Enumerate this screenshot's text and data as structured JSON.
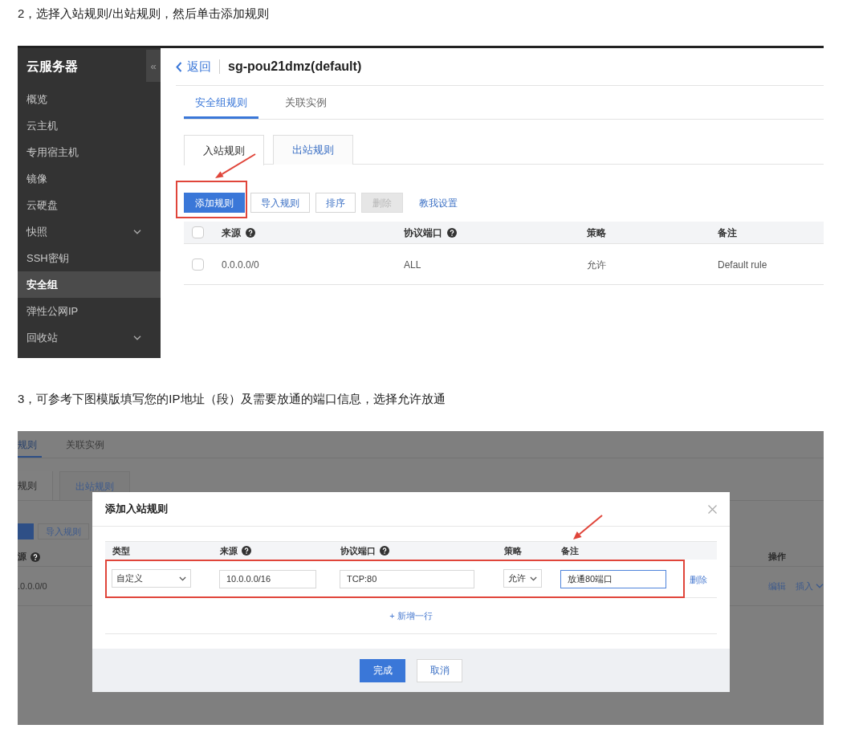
{
  "step_2": {
    "heading": "2，选择入站规则/出站规则，然后单击添加规则",
    "console": {
      "sidebar": {
        "title": "云服务器",
        "collapse": "«",
        "items": [
          {
            "label": "概览",
            "selected": false,
            "submenu": false
          },
          {
            "label": "云主机",
            "selected": false,
            "submenu": false
          },
          {
            "label": "专用宿主机",
            "selected": false,
            "submenu": false
          },
          {
            "label": "镜像",
            "selected": false,
            "submenu": false
          },
          {
            "label": "云硬盘",
            "selected": false,
            "submenu": false
          },
          {
            "label": "快照",
            "selected": false,
            "submenu": true
          },
          {
            "label": "SSH密钥",
            "selected": false,
            "submenu": false
          },
          {
            "label": "安全组",
            "selected": true,
            "submenu": false
          },
          {
            "label": "弹性公网IP",
            "selected": false,
            "submenu": false
          },
          {
            "label": "回收站",
            "selected": false,
            "submenu": true
          }
        ]
      },
      "header": {
        "back": "返回",
        "title": "sg-pou21dmz(default)"
      },
      "tabs": [
        {
          "label": "安全组规则",
          "selected": true
        },
        {
          "label": "关联实例",
          "selected": false
        }
      ],
      "sub_tabs": [
        {
          "label": "入站规则",
          "selected": true
        },
        {
          "label": "出站规则",
          "selected": false
        }
      ],
      "toolbar": [
        {
          "label": "添加规则",
          "kind": "primary"
        },
        {
          "label": "导入规则",
          "kind": "default"
        },
        {
          "label": "排序",
          "kind": "default"
        },
        {
          "label": "删除",
          "kind": "disabled"
        },
        {
          "label": "教我设置",
          "kind": "link"
        }
      ],
      "table": {
        "select_all_checked": false,
        "columns": [
          {
            "label": "来源",
            "help": true
          },
          {
            "label": "协议端口",
            "help": true
          },
          {
            "label": "策略",
            "help": false
          },
          {
            "label": "备注",
            "help": false
          }
        ],
        "rows": [
          {
            "checked": false,
            "cells": [
              "0.0.0.0/0",
              "ALL",
              "允许",
              "Default rule"
            ]
          }
        ]
      }
    }
  },
  "step_3": {
    "heading": "3，可参考下图模版填写您的IP地址（段）及需要放通的端口信息，选择允许放通",
    "background": {
      "tabs": [
        {
          "label": "规则",
          "selected": true
        },
        {
          "label": "关联实例",
          "selected": false
        }
      ],
      "sub_tabs": [
        {
          "label": "规则",
          "selected": true
        },
        {
          "label": "出站规则",
          "selected": false
        }
      ],
      "toolbar": [
        {
          "kind": "primary"
        },
        {
          "label": "导入规则",
          "kind": "default"
        }
      ],
      "table": {
        "columns": [
          {
            "label": "源",
            "help": true
          },
          {
            "label": "操作",
            "help": false
          }
        ],
        "rows": [
          {
            "cells": [
              ".0.0.0/0"
            ],
            "actions": [
              {
                "label": "编辑",
                "dropdown": false
              },
              {
                "label": "插入",
                "dropdown": true
              }
            ]
          }
        ]
      }
    },
    "dialog": {
      "title": "添加入站规则",
      "columns": [
        {
          "label": "类型",
          "help": false
        },
        {
          "label": "来源",
          "help": true
        },
        {
          "label": "协议端口",
          "help": true
        },
        {
          "label": "策略",
          "help": false
        },
        {
          "label": "备注",
          "help": false
        }
      ],
      "rows": [
        {
          "fields": [
            {
              "kind": "select",
              "value": "自定义"
            },
            {
              "kind": "input",
              "value": "10.0.0.0/16",
              "focused": false
            },
            {
              "kind": "input",
              "value": "TCP:80",
              "focused": false
            },
            {
              "kind": "select",
              "value": "允许"
            },
            {
              "kind": "input",
              "value": "放通80端口",
              "focused": true
            }
          ],
          "delete": "删除"
        }
      ],
      "add_row": "+ 新增一行",
      "buttons": [
        {
          "label": "完成",
          "primary": true
        },
        {
          "label": "取消",
          "primary": false
        }
      ]
    }
  }
}
